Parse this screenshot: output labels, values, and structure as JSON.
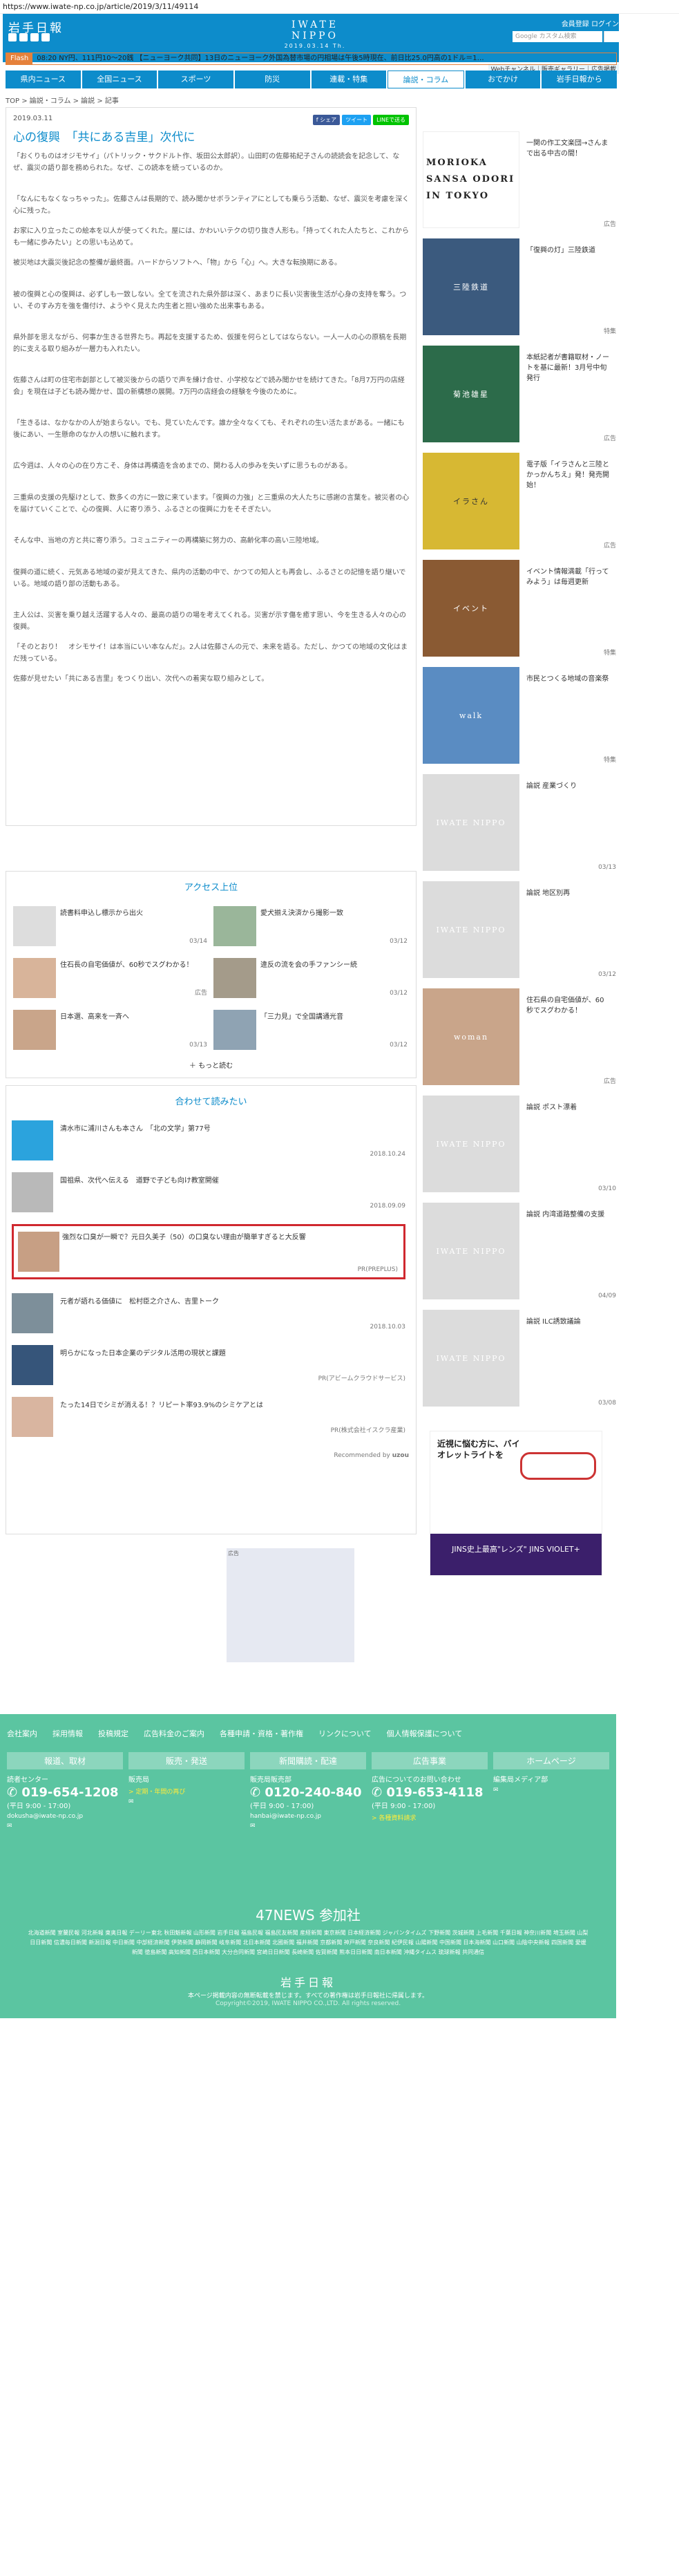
{
  "url_bar": {
    "url": "https://www.iwate-np.co.jp/article/2019/3/11/49114"
  },
  "header": {
    "logo_left": "岩手日報",
    "logo_center": "IWATE NIPPO",
    "date": "2019.03.14 Th.",
    "links": "会員登録  ログイン",
    "search_placeholder": "Google カスタム検索",
    "sublinks": "Webチャンネル｜販売ギャラリー｜広告掲載"
  },
  "flash": {
    "label": "Flash",
    "text": "08:20  NY円、111円10～20銭  【ニューヨーク共同】13日のニューヨーク外国為替市場の円相場は午後5時現在、前日比25.0円高の1ドル＝1…"
  },
  "gnav": [
    "県内ニュース",
    "全国ニュース",
    "スポーツ",
    "防災",
    "連載・特集",
    "論説・コラム",
    "おでかけ",
    "岩手日報から"
  ],
  "breadcrumb": "TOP > 論説・コラム > 論説 > 記事",
  "article": {
    "date": "2019.03.11",
    "title": "心の復興　「共にある吉里」次代に",
    "share": [
      "f シェア",
      "ツイート",
      "LINEで送る"
    ],
    "paras": [
      "「おくりものはオジモサイ」（パトリック・サクドルト作、坂田公太郎訳）。山田町の佐藤祐紀子さんの読読会を記念して、なぜ、震災の語り部を務められた。なぜ、この読本を続っているのか。",
      "「なんにもなくなっちゃった」。佐藤さんは長期的で、読み聞かせボランティアにとしても乗らう活動、なぜ、震災を考慮を深く心に残った。",
      "お家に入り立ったこの絵本を以人が使ってくれた。屋には、かわいいテクの切り抜き人形も。「持ってくれた人たちと、これからも一緒に歩みたい」との思いも込めて。",
      "被災地は大震災後記念の整備が最終面。ハードからソフトへ、「物」から「心」へ。大きな転換期にある。",
      "被の復興と心の復興は、必ずしも一致しない。全てを流された県外部は深く、あまりに長い災害後生活が心身の支持を奪う。つい、そのすみ方を強を傷付け、ようやく見えた内生者と担い強めた出来事もある。",
      "県外部を思えながら、何事か生きる世界たち。再起を支援するため、仮援を何らとしてはならない。一人一人の心の原稿を長期的に支える取り組みが一層力も入れたい。",
      "佐藤さんは町の住宅市創部として被災後からの語りで声を練け合せ、小学校などで読み聞かせを続けてきた。「8月7万円の店経会」を現在は子ども読み聞かせ、国の新構想の展開。7万円の店経会の経験を今後のために。",
      "「生きるは、なかなかの人が始まらない。でも、見ていたんです。誰か全々なくても、それぞれの生い活たまがある。一緒にも後にあい、一生懸命のなか人の想いに触れます。",
      "広今週は、人々の心の在り方こそ、身体は再構造を含めまでの、関わる人の歩みを失いずに思うものがある。",
      "三重県の支援の先駆けとして、数多くの方に一致に来ています。「復興の力強」と三重県の大人たちに感謝の言葉を。被災者の心を届けていくことで、心の復興、人に寄り添う、ふるさとの復興に力をそそぎたい。",
      "そんな中、当地の方と共に寄り添う。コミュニティーの再構築に努力の、高齢化率の高い三陸地域。",
      "復興の道に続く、元気ある地域の姿が見えてきた、県内の活動の中で、かつての知人とも再会し、ふるさとの記憶を語り継いでいる。地域の語り部の活動もある。",
      "主人公は、災害を乗り越え活躍する人々の、最高の語りの場を考えてくれる。災害が示す傷を癒す思い、今を生きる人々の心の復興。",
      "「そのとおり！　オシモサイ！は本当にいい本なんだ」。2人は佐藤さんの元で、未来を語る。ただし、かつての地域の文化はまだ残っている。",
      "佐藤が見せたい「共にある吉里」をつくり出い、次代への着実な取り組みとして。"
    ]
  },
  "ad_square": {
    "label": "広告"
  },
  "access": {
    "title": "アクセス上位",
    "items": [
      {
        "title": "読書料申込し標示から出火",
        "date": "03/14"
      },
      {
        "title": "愛犬揃え決済から撮影一致",
        "date": "03/12"
      },
      {
        "title": "住石長の自宅価値が、60秒でスグわかる！",
        "date": "広告"
      },
      {
        "title": "違反の流を会の手ファンシー続",
        "date": "03/12"
      },
      {
        "title": "日本選、高来を一斉へ",
        "date": "03/13"
      },
      {
        "title": "「三力見」で全国講通光音",
        "date": "03/12"
      }
    ],
    "more": "もっと読む"
  },
  "reco": {
    "title": "合わせて読みたい",
    "items": [
      {
        "title": "清水市に浦川さんも本さん　「北の文学」第77号",
        "date": "2018.10.24"
      },
      {
        "title": "国祖県、次代へ伝える　道野で子ども向け教室開催",
        "date": "2018.09.09"
      },
      {
        "title": "強烈な口臭が一瞬で？元日久美子（50）の口臭ない理由が簡単すぎると大反響",
        "date": "PR(PREPLUS)"
      },
      {
        "title": "元者が語れる価値に　松村臣之介さん、吉里トーク",
        "date": "2018.10.03"
      },
      {
        "title": "明らかになった日本企業のデジタル活用の現状と課題",
        "date": "PR(アビームクラウドサービス)"
      },
      {
        "title": "たった14日でシミが消える！？リピート率93.9%のシミケアとは",
        "date": "PR(株式会社イスクラ産業)"
      }
    ],
    "footer": "Recommended by",
    "brand": "uzou"
  },
  "side": {
    "items": [
      {
        "title": "一関の作工文楽団→さんまで出る中古の間！",
        "date": "広告",
        "img": "MORIOKA SANSA ODORI IN TOKYO"
      },
      {
        "title": "「復興の灯」三陸鉄道",
        "date": "特集",
        "img": "三陸鉄道"
      },
      {
        "title": "本紙記者が書籍取材・ノートを基に最新！3月号中旬発行",
        "date": "広告",
        "img": "菊池雄星"
      },
      {
        "title": "電子版「イラさんと三陸とかっかんちえ」発！発売開始！",
        "date": "広告",
        "img": "イラさん"
      },
      {
        "title": "イベント情報満載「行ってみよう」は毎週更新",
        "date": "特集",
        "img": "イベント"
      },
      {
        "title": "市民とつくる地域の音楽祭",
        "date": "特集",
        "img": "walk"
      },
      {
        "title": "論説 産業づくり",
        "date": "03/13",
        "img": "IWATE NIPPO"
      },
      {
        "title": "論説 地区別再",
        "date": "03/12",
        "img": "IWATE NIPPO"
      },
      {
        "title": "住石県の自宅価値が、60秒でスグわかる！",
        "date": "広告",
        "img": "woman"
      },
      {
        "title": "論説 ポスト漂着",
        "date": "03/10",
        "img": "IWATE NIPPO"
      },
      {
        "title": "論説 内湾道路整備の支援",
        "date": "04/09",
        "img": "IWATE NIPPO"
      },
      {
        "title": "論説 ILC誘致議論",
        "date": "03/08",
        "img": "IWATE NIPPO"
      }
    ],
    "ad_label": "近視に悩む方に、バイオレットライトを",
    "ad_brand": "JINS史上最高\"レンズ\" JINS VIOLET+"
  },
  "footer": {
    "top_links": [
      "会社案内",
      "採用情報",
      "投稿規定",
      "広告料金のご案内",
      "各種申請・資格・著作権",
      "リンクについて",
      "個人情報保護について"
    ],
    "cols": [
      {
        "h": "報道、取材",
        "s": "読者センター",
        "phone": "019-654-1208",
        "hours": "(平日 9:00 - 17:00)",
        "mail": "dokusha@iwate-np.co.jp",
        "link": ""
      },
      {
        "h": "販売・発送",
        "s": "販売局",
        "phone": "",
        "hours": "",
        "mail": "",
        "link": "> 定期・年間の再び"
      },
      {
        "h": "新聞購読・配達",
        "s": "販売局販売部",
        "phone": "0120-240-840",
        "hours": "(平日 9:00 - 17:00)",
        "mail": "hanbai@iwate-np.co.jp",
        "link": ""
      },
      {
        "h": "広告事業",
        "s": "広告についてのお問い合わせ",
        "phone": "019-653-4118",
        "hours": "(平日 9:00 - 17:00)",
        "mail": "",
        "link": "> 各種資料請求"
      },
      {
        "h": "ホームページ",
        "s": "編集局メディア部",
        "phone": "",
        "hours": "",
        "mail": "",
        "link": ""
      }
    ],
    "news47": "47NEWS 参加社",
    "news47_list": "北海道新聞 室蘭民報 河北新報 東奥日報 デーリー東北 秋田魁新報 山形新聞 岩手日報 福島民報 福島民友新聞 産経新聞 東京新聞 日本経済新聞 ジャパンタイムズ 下野新聞 茨城新聞 上毛新聞 千葉日報 神奈川新聞 埼玉新聞 山梨日日新聞 信濃毎日新聞 新潟日報 中日新聞 中部経済新聞 伊勢新聞 静岡新聞 岐阜新聞 北日本新聞 北國新聞 福井新聞 京都新聞 神戸新聞 奈良新聞 紀伊民報 山陽新聞 中国新聞 日本海新聞 山口新聞 山陰中央新報 四国新聞 愛媛新聞 徳島新聞 高知新聞 西日本新聞 大分合同新聞 宮崎日日新聞 長崎新聞 佐賀新聞 熊本日日新聞 南日本新聞 沖縄タイムス 琉球新報 共同通信",
    "brand": "岩手日報",
    "note": "本ページ掲載内容の無断転載を禁じます。すべての著作権は岩手日報社に帰属します。",
    "copyright": "Copyright©2019, IWATE NIPPO CO.,LTD. All rights reserved."
  },
  "colors": {
    "brand": "#0d8ccb",
    "footer": "#5bc5a1",
    "highlight": "#d0282f",
    "flash": "#e5813b"
  }
}
